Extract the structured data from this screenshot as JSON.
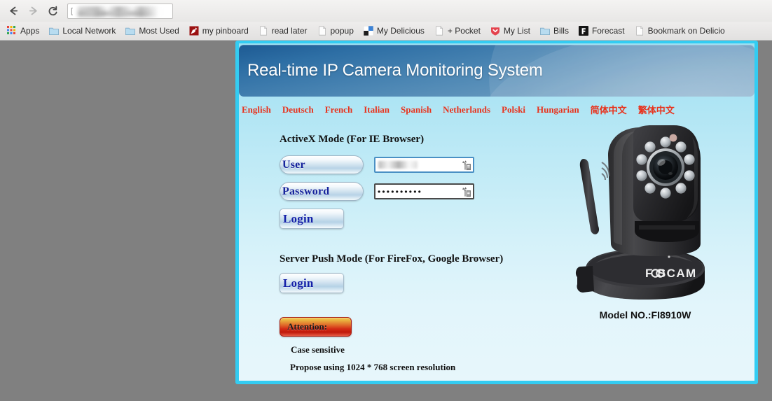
{
  "browser": {
    "nav": {
      "back_label": "Back",
      "forward_label": "Forward",
      "reload_label": "Reload"
    },
    "url_bar": {
      "value": "",
      "placeholder": "",
      "redacted": true,
      "leading_char": "["
    },
    "bookmarks": [
      {
        "label": "Apps",
        "icon": "apps-grid-icon"
      },
      {
        "label": "Local Network",
        "icon": "folder-icon"
      },
      {
        "label": "Most Used",
        "icon": "folder-icon"
      },
      {
        "label": "my pinboard",
        "icon": "pushpin-icon"
      },
      {
        "label": "read later",
        "icon": "page-icon"
      },
      {
        "label": "popup",
        "icon": "page-icon"
      },
      {
        "label": "My Delicious",
        "icon": "delicious-squares-icon"
      },
      {
        "label": "+ Pocket",
        "icon": "page-icon"
      },
      {
        "label": "My List",
        "icon": "shield-heart-icon"
      },
      {
        "label": "Bills",
        "icon": "folder-icon"
      },
      {
        "label": "Forecast",
        "icon": "forecast-f-icon"
      },
      {
        "label": "Bookmark on Delicio",
        "icon": "page-icon"
      }
    ]
  },
  "page": {
    "banner_title": "Real-time IP Camera Monitoring System",
    "languages": [
      {
        "label": "English"
      },
      {
        "label": "Deutsch"
      },
      {
        "label": "French"
      },
      {
        "label": "Italian"
      },
      {
        "label": "Spanish"
      },
      {
        "label": "Netherlands"
      },
      {
        "label": "Polski"
      },
      {
        "label": "Hungarian"
      },
      {
        "label": "简体中文"
      },
      {
        "label": "繁体中文"
      }
    ],
    "activex": {
      "title": "ActiveX Mode (For IE Browser)",
      "user_label": "User",
      "password_label": "Password",
      "user_value": "",
      "password_value": "••••••••••",
      "login_label": "Login"
    },
    "serverpush": {
      "title": "Server Push Mode (For FireFox, Google Browser)",
      "login_label": "Login"
    },
    "attention": {
      "badge_label": "Attention:",
      "note_1": "Case sensitive",
      "note_2": "Propose using 1024 * 768 screen resolution"
    },
    "camera": {
      "brand": "FOSCAM",
      "model_label": "Model NO.:FI8910W"
    },
    "colors": {
      "frame": "#33ccf2",
      "lang_link": "#e8321c",
      "button_text": "#16239c",
      "banner_start": "#1d5a93",
      "banner_end": "#7ba6c6"
    }
  }
}
